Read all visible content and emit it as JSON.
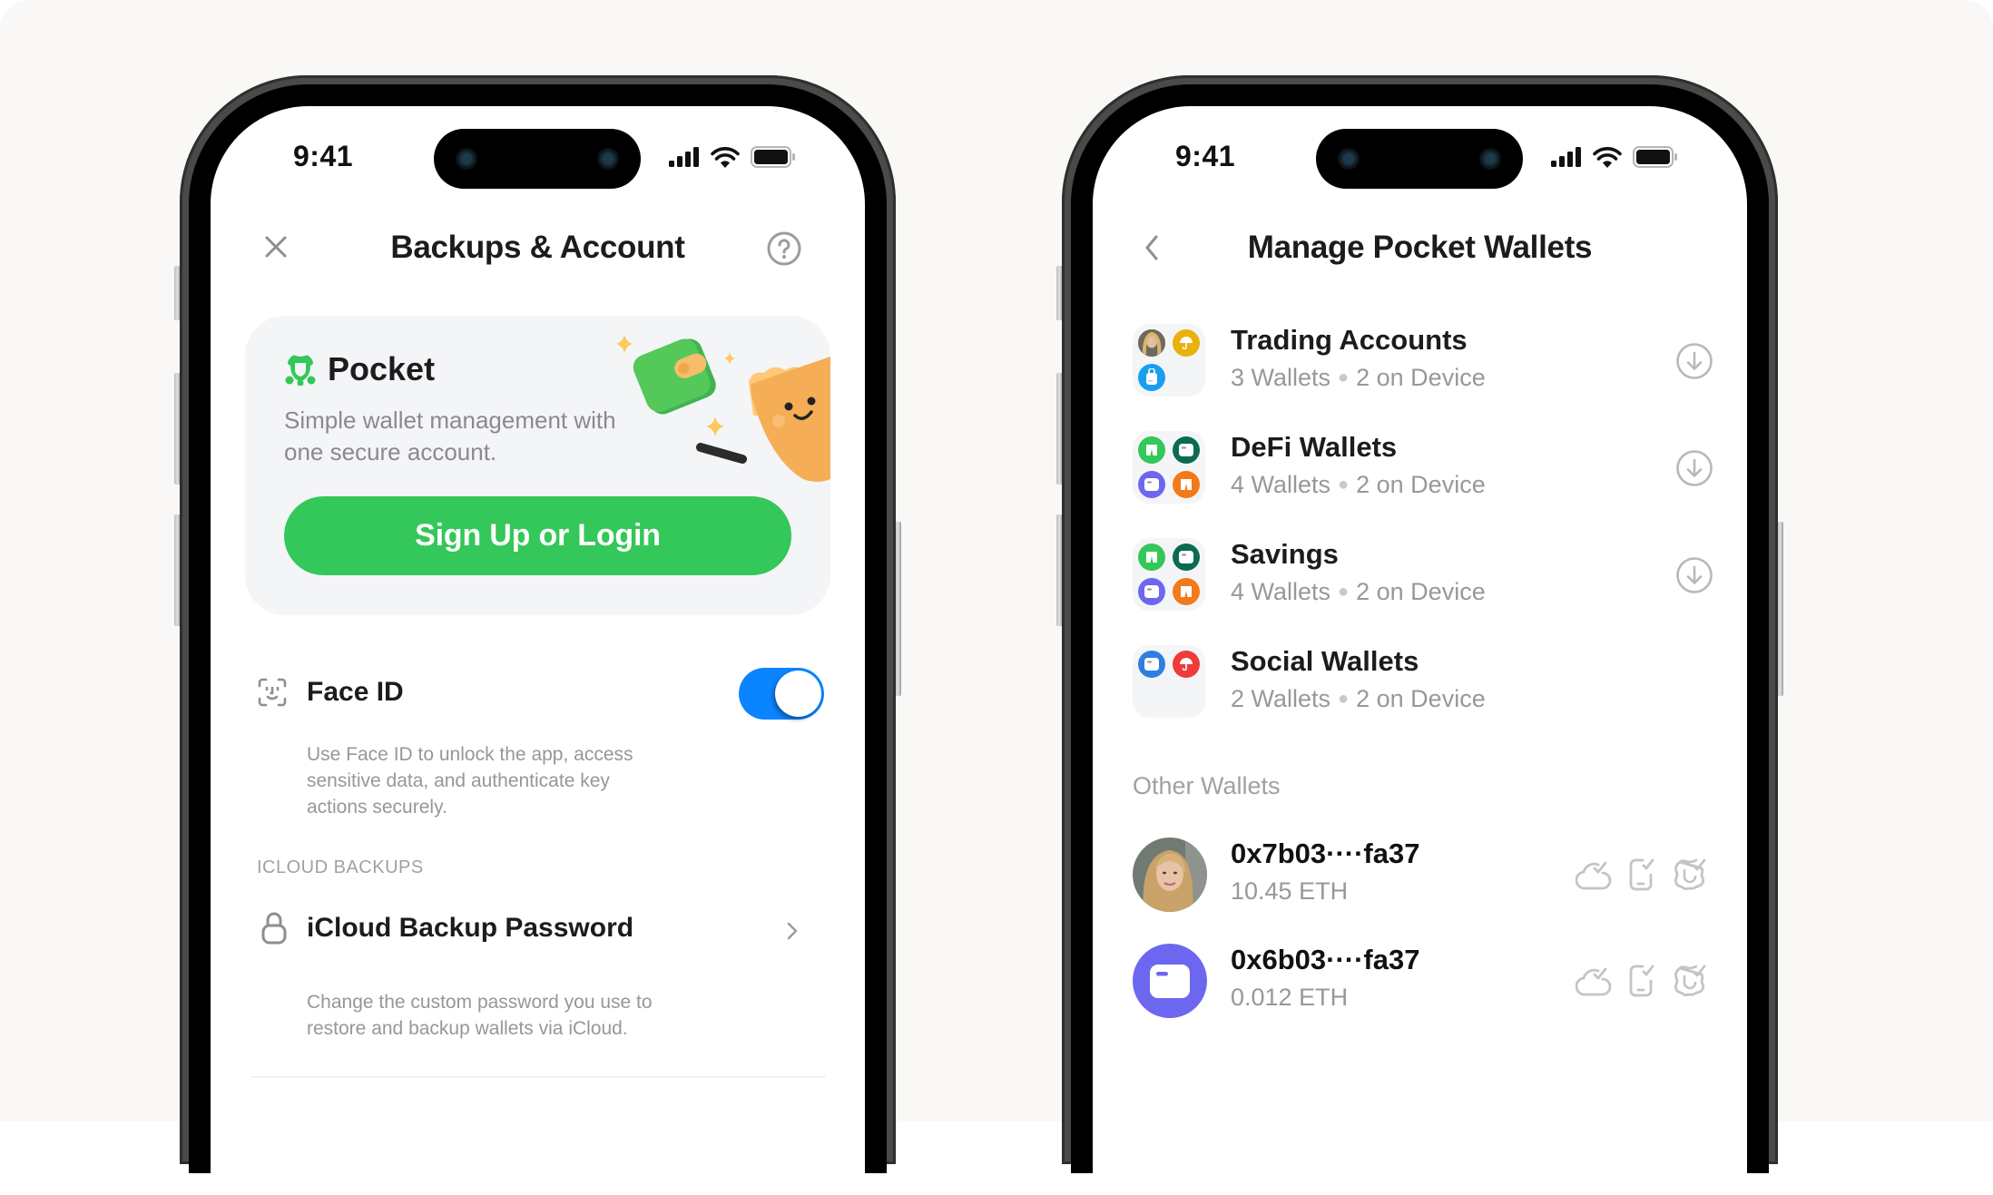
{
  "status_bar": {
    "time": "9:41"
  },
  "left_screen": {
    "nav": {
      "title": "Backups & Account",
      "close_icon": "close-icon",
      "help_icon": "question-circle-icon"
    },
    "promo_card": {
      "brand_name": "Pocket",
      "tagline": "Simple wallet management with one secure account.",
      "cta_label": "Sign Up or Login",
      "cta_color": "#34c759",
      "illustration": "wallet-mascot-illustration"
    },
    "face_id": {
      "label": "Face ID",
      "enabled": true,
      "toggle_color": "#0a84ff",
      "description": "Use Face ID to unlock the app, access sensitive data, and authenticate key actions securely."
    },
    "icloud_section": {
      "header": "ICLOUD BACKUPS",
      "item_label": "iCloud Backup Password",
      "item_description": "Change the custom password you use to restore and backup wallets via iCloud."
    }
  },
  "right_screen": {
    "nav": {
      "title": "Manage Pocket Wallets",
      "back_icon": "chevron-left-icon"
    },
    "groups": [
      {
        "title": "Trading Accounts",
        "wallets": "3 Wallets",
        "on_device": "2 on Device",
        "icons": [
          {
            "type": "photo",
            "color": "#8a7660"
          },
          {
            "type": "umbrella",
            "color": "#e9b10b"
          },
          {
            "type": "bag",
            "color": "#1a9ef0"
          }
        ],
        "download": true
      },
      {
        "title": "DeFi Wallets",
        "wallets": "4 Wallets",
        "on_device": "2 on Device",
        "icons": [
          {
            "type": "shorts",
            "color": "#34c759"
          },
          {
            "type": "card",
            "color": "#0b6b4f"
          },
          {
            "type": "card",
            "color": "#6d67f0"
          },
          {
            "type": "shorts",
            "color": "#f27a1a"
          }
        ],
        "download": true
      },
      {
        "title": "Savings",
        "wallets": "4 Wallets",
        "on_device": "2 on Device",
        "icons": [
          {
            "type": "shorts",
            "color": "#34c759"
          },
          {
            "type": "card",
            "color": "#0b6b4f"
          },
          {
            "type": "card",
            "color": "#6d67f0"
          },
          {
            "type": "shorts",
            "color": "#f27a1a"
          }
        ],
        "download": true
      },
      {
        "title": "Social Wallets",
        "wallets": "2 Wallets",
        "on_device": "2 on Device",
        "icons": [
          {
            "type": "card",
            "color": "#2f7fe0"
          },
          {
            "type": "umbrella",
            "color": "#ef3b3b"
          }
        ],
        "download": false
      }
    ],
    "other_label": "Other Wallets",
    "other_wallets": [
      {
        "address": "0x7b03····fa37",
        "balance": "10.45 ETH",
        "avatar": "photo"
      },
      {
        "address": "0x6b03····fa37",
        "balance": "0.012 ETH",
        "avatar": "card",
        "avatar_color": "#6d67f0"
      }
    ]
  }
}
